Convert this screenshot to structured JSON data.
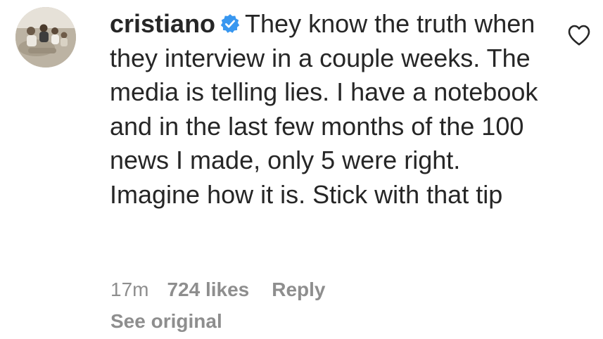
{
  "comment": {
    "username": "cristiano",
    "verified_icon": "verified-badge-icon",
    "text": "They know the truth when they interview in a couple weeks. The media is telling lies. I have a notebook and in the last few months of the 100 news I made, only 5 were right. Imagine how it is. Stick with that tip",
    "timestamp": "17m",
    "likes": "724 likes",
    "reply_label": "Reply",
    "see_original_label": "See original",
    "like_icon": "heart-icon"
  },
  "colors": {
    "text": "#262626",
    "secondary": "#8e8e8e",
    "verified": "#3897f0"
  }
}
